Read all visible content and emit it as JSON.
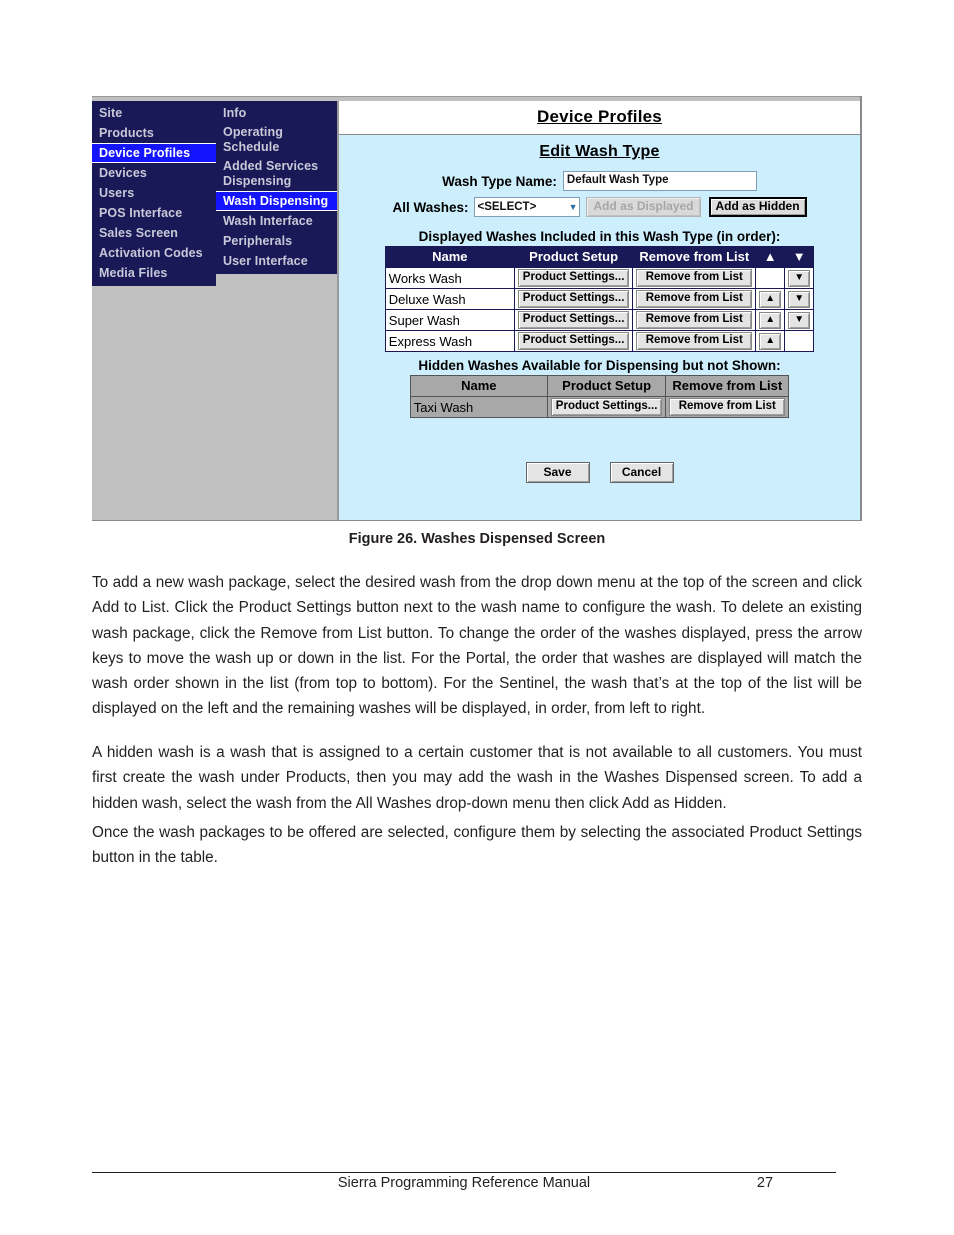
{
  "screenshot": {
    "nav_primary": [
      {
        "label": "Site",
        "active": false
      },
      {
        "label": "Products",
        "active": false
      },
      {
        "label": "Device Profiles",
        "active": true
      },
      {
        "label": "Devices",
        "active": false
      },
      {
        "label": "Users",
        "active": false
      },
      {
        "label": "POS Interface",
        "active": false
      },
      {
        "label": "Sales Screen",
        "active": false
      },
      {
        "label": "Activation Codes",
        "active": false
      },
      {
        "label": "Media Files",
        "active": false
      }
    ],
    "nav_secondary": [
      {
        "label": "Info",
        "active": false
      },
      {
        "label": "Operating Schedule",
        "active": false
      },
      {
        "label": "Added Services Dispensing",
        "active": false
      },
      {
        "label": "Wash Dispensing",
        "active": true
      },
      {
        "label": "Wash Interface",
        "active": false
      },
      {
        "label": "Peripherals",
        "active": false
      },
      {
        "label": "User Interface",
        "active": false
      }
    ],
    "page_title": "Device Profiles",
    "section_title": "Edit Wash Type",
    "form": {
      "wash_type_name_label": "Wash Type Name:",
      "wash_type_name_value": "Default Wash Type",
      "all_washes_label": "All Washes:",
      "all_washes_value": "<SELECT>",
      "add_as_displayed_label": "Add as Displayed",
      "add_as_hidden_label": "Add as Hidden"
    },
    "displayed_table": {
      "caption": "Displayed Washes Included in this Wash Type (in order):",
      "headers": [
        "Name",
        "Product Setup",
        "Remove from List",
        "▲",
        "▼"
      ],
      "rows": [
        {
          "name": "Works Wash",
          "product_setup": "Product Settings...",
          "remove": "Remove from List",
          "up": "",
          "down": "▼"
        },
        {
          "name": "Deluxe Wash",
          "product_setup": "Product Settings...",
          "remove": "Remove from List",
          "up": "▲",
          "down": "▼"
        },
        {
          "name": "Super Wash",
          "product_setup": "Product Settings...",
          "remove": "Remove from List",
          "up": "▲",
          "down": "▼"
        },
        {
          "name": "Express Wash",
          "product_setup": "Product Settings...",
          "remove": "Remove from List",
          "up": "▲",
          "down": ""
        }
      ]
    },
    "hidden_table": {
      "caption": "Hidden Washes Available for Dispensing but not Shown:",
      "headers": [
        "Name",
        "Product Setup",
        "Remove from List"
      ],
      "rows": [
        {
          "name": "Taxi Wash",
          "product_setup": "Product Settings...",
          "remove": "Remove from List"
        }
      ]
    },
    "actions": {
      "save_label": "Save",
      "cancel_label": "Cancel"
    },
    "colors": {
      "nav_background": "#191957",
      "nav_highlight": "#1414ff",
      "panel_background": "#cdeefc",
      "table_header": "#191957",
      "hidden_table_header": "#a8a8a8"
    }
  },
  "document": {
    "caption": "Figure 26. Washes Dispensed Screen",
    "paragraph_1": "To add a new wash package, select the desired wash from the drop down menu at the top of the screen and click Add to List. Click the Product Settings button next to the wash name to configure the wash. To delete an existing wash package, click the Remove from List button. To change the order of the washes displayed, press the arrow keys to move the wash up or down in the list. For the Portal, the order that washes are displayed will match the wash order shown in the list (from top to bottom). For the Sentinel, the wash that’s at the top of the list will be displayed on the left and the remaining washes will be displayed, in order, from left to right.",
    "paragraph_2": "A hidden wash is a wash that is assigned to a certain customer that is not available to all customers. You must first create the wash under Products, then you may add the wash in the Washes Dispensed screen. To add a hidden wash, select the wash from the All Washes drop-down menu then click Add as Hidden.",
    "paragraph_3": "Once the wash packages to be offered are selected, configure them by selecting the associated Product Settings button in the table.",
    "footer_title": "Sierra Programming Reference Manual",
    "footer_page": "27"
  }
}
